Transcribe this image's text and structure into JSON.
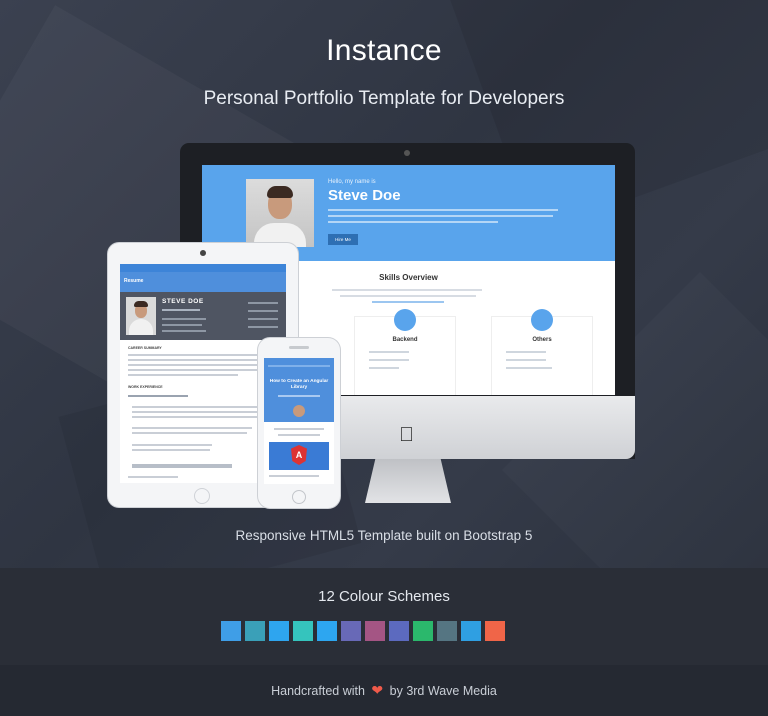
{
  "header": {
    "title": "Instance",
    "subtitle": "Personal Portfolio Template for Developers"
  },
  "mockup": {
    "desktop": {
      "hello": "Hello, my name is",
      "name": "Steve Doe",
      "button": "Hire Me",
      "section_title": "Skills Overview",
      "cards": [
        "Backend",
        "Others"
      ]
    },
    "tablet": {
      "brand": "Resume",
      "name": "STEVE DOE",
      "role": "Full Stack Developer",
      "sections": [
        "CAREER SUMMARY",
        "WORK EXPERIENCE"
      ]
    },
    "phone": {
      "post_title": "How to Create an Angular Library",
      "logo_letter": "A"
    }
  },
  "tagline": "Responsive HTML5 Template built on Bootstrap 5",
  "colour_schemes": {
    "title": "12 Colour Schemes",
    "colors": [
      "#3f9ee7",
      "#3aa0b8",
      "#2ea5ef",
      "#35c4bd",
      "#2da6f0",
      "#6869b7",
      "#a45584",
      "#5c6abf",
      "#2bb86c",
      "#557582",
      "#2f9fe2",
      "#f06548"
    ]
  },
  "footer": {
    "prefix": "Handcrafted with",
    "heart_icon": "heart-icon",
    "suffix": "by 3rd Wave Media"
  }
}
